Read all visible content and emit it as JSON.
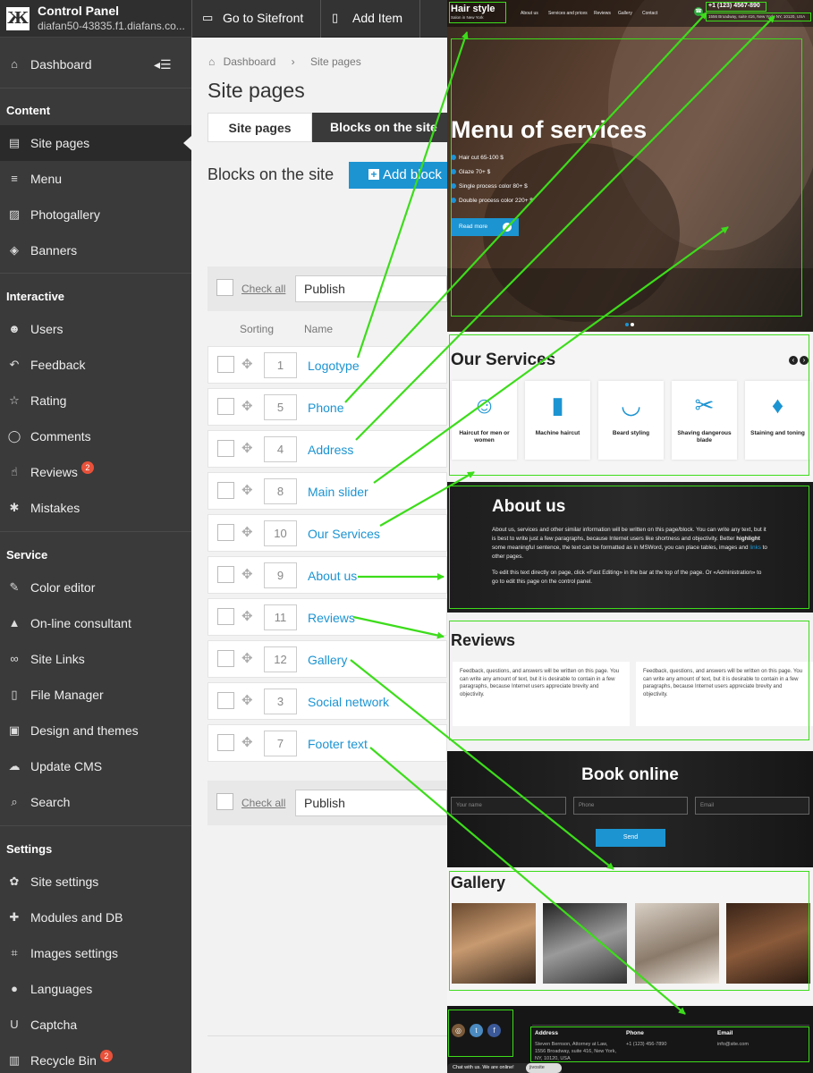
{
  "brand": {
    "title": "Control Panel",
    "domain": "diafan50-43835.f1.diafans.co..."
  },
  "topbar": {
    "sitefront": "Go to Sitefront",
    "add_item": "Add Item"
  },
  "sidebar": {
    "dashboard": "Dashboard",
    "sections": [
      {
        "title": "Content",
        "items": [
          {
            "label": "Site pages",
            "icon": "page-icon",
            "active": true
          },
          {
            "label": "Menu",
            "icon": "list-icon"
          },
          {
            "label": "Photogallery",
            "icon": "image-icon"
          },
          {
            "label": "Banners",
            "icon": "tag-icon"
          }
        ]
      },
      {
        "title": "Interactive",
        "items": [
          {
            "label": "Users",
            "icon": "users-icon"
          },
          {
            "label": "Feedback",
            "icon": "reply-icon"
          },
          {
            "label": "Rating",
            "icon": "star-icon"
          },
          {
            "label": "Comments",
            "icon": "comment-icon"
          },
          {
            "label": "Reviews",
            "icon": "thumbs-up-icon",
            "badge": "2"
          },
          {
            "label": "Mistakes",
            "icon": "bug-icon"
          }
        ]
      },
      {
        "title": "Service",
        "items": [
          {
            "label": "Color editor",
            "icon": "brush-icon"
          },
          {
            "label": "On-line consultant",
            "icon": "graduation-icon"
          },
          {
            "label": "Site Links",
            "icon": "link-icon"
          },
          {
            "label": "File Manager",
            "icon": "file-icon"
          },
          {
            "label": "Design and themes",
            "icon": "design-icon"
          },
          {
            "label": "Update CMS",
            "icon": "cloud-download-icon"
          },
          {
            "label": "Search",
            "icon": "search-icon"
          }
        ]
      },
      {
        "title": "Settings",
        "items": [
          {
            "label": "Site settings",
            "icon": "gears-icon"
          },
          {
            "label": "Modules and DB",
            "icon": "puzzle-icon"
          },
          {
            "label": "Images settings",
            "icon": "crop-icon"
          },
          {
            "label": "Languages",
            "icon": "globe-icon"
          },
          {
            "label": "Captcha",
            "icon": "captcha-icon"
          },
          {
            "label": "Recycle Bin",
            "icon": "trash-icon",
            "badge": "2"
          }
        ]
      }
    ]
  },
  "main": {
    "breadcrumb": {
      "home": "Dashboard",
      "sep": "›",
      "current": "Site pages"
    },
    "title": "Site pages",
    "tabs": [
      {
        "label": "Site pages",
        "active": true
      },
      {
        "label": "Blocks on the site",
        "active": false
      }
    ],
    "subtitle": "Blocks on the site",
    "add_block": "Add block",
    "check_all": "Check all",
    "action": "Publish",
    "columns": {
      "sorting": "Sorting",
      "name": "Name"
    },
    "rows": [
      {
        "sort": "1",
        "name": "Logotype"
      },
      {
        "sort": "5",
        "name": "Phone"
      },
      {
        "sort": "4",
        "name": "Address"
      },
      {
        "sort": "8",
        "name": "Main slider"
      },
      {
        "sort": "10",
        "name": "Our Services"
      },
      {
        "sort": "9",
        "name": "About us"
      },
      {
        "sort": "11",
        "name": "Reviews"
      },
      {
        "sort": "12",
        "name": "Gallery"
      },
      {
        "sort": "3",
        "name": "Social network"
      },
      {
        "sort": "7",
        "name": "Footer text"
      }
    ]
  },
  "preview": {
    "logo": {
      "title": "Hair style",
      "subtitle": "Salon in New York"
    },
    "nav": [
      "About us",
      "Services and prices",
      "Reviews",
      "Gallery",
      "Contact"
    ],
    "phone": "+1 (123) 4567-890",
    "address": "1556 Broadway, suite 416, New York, NY, 10120, USA",
    "hero": {
      "title": "Menu of services",
      "list": [
        "Hair cut 65-100 $",
        "Glaze 70+ $",
        "Single process color 80+ $",
        "Double process color 220+ $"
      ],
      "button": "Read more"
    },
    "services": {
      "title": "Our Services",
      "items": [
        {
          "label": "Haircut for men or women",
          "icon": "face-icon"
        },
        {
          "label": "Machine haircut",
          "icon": "trimmer-icon"
        },
        {
          "label": "Beard styling",
          "icon": "beard-icon"
        },
        {
          "label": "Shaving dangerous blade",
          "icon": "razor-icon"
        },
        {
          "label": "Staining and toning",
          "icon": "spray-icon"
        }
      ]
    },
    "about": {
      "title": "About us",
      "p1a": "About us, services and other similar information will be written on this page/block. You can write any text, but it is best to write just a few paragraphs, because Internet users like shortness and objectivity. Better ",
      "p1b": "highlight",
      "p1c": " some meaningful sentence, the text can be formatted as in MSWord, you can place tables, images and ",
      "p1d": "links",
      "p1e": " to other pages.",
      "p2": "To edit this text directly on page, click «Fast Editing» in the bar at the top of the page. Or «Administration» to go to edit this page on the control panel."
    },
    "reviews": {
      "title": "Reviews",
      "text": "Feedback, questions, and answers will be written on this page. You can write any amount of text, but it is desirable to contain in a few paragraphs, because Internet users appreciate brevity and objectivity."
    },
    "book": {
      "title": "Book online",
      "name": "Your name",
      "phone": "Phone",
      "email": "Email",
      "send": "Send"
    },
    "gallery": {
      "title": "Gallery"
    },
    "footer": {
      "address_head": "Address",
      "address_text": "Steven Bernson, Attorney at Law, 1556 Broadway, suite 416, New York, NY, 10120, USA",
      "phone_head": "Phone",
      "phone_text": "+1 (123) 456-7890",
      "email_head": "Email",
      "email_text": "info@site.com",
      "chat": "Chat with us. We are online!",
      "jivosite": "jivosite"
    }
  },
  "colors": {
    "accent": "#1c94d2",
    "highlight": "#3ddc1b",
    "sidebar": "#3a3a3a"
  }
}
